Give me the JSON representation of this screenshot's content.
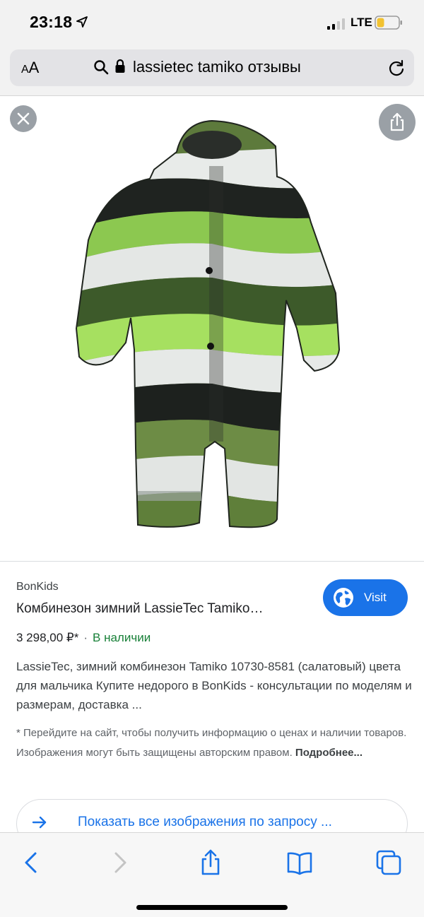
{
  "status_bar": {
    "time": "23:18",
    "network": "LTE"
  },
  "browser": {
    "text_size_label": "AA",
    "url_text": "lassietec tamiko отзывы"
  },
  "result": {
    "source": "BonKids",
    "title": "Комбинезон зимний LassieTec Tamiko…",
    "visit_label": "Visit",
    "price": "3 298,00 ₽*",
    "separator": "·",
    "availability": "В наличии",
    "description": "LassieTec, зимний комбинезон Tamiko 10730-8581 (салатовый) цвета для мальчика Купите недорого в BonKids - консультации по моделям и размерам, доставка ...",
    "disclaimer": "* Перейдите на сайт, чтобы получить информацию о ценах и наличии товаров. Изображения могут быть защищены авторским правом.",
    "more_link": "Подробнее...",
    "show_all_label": "Показать все изображения по запросу ..."
  },
  "colors": {
    "accent_blue": "#1a73e8",
    "in_stock_green": "#188038",
    "overlay_gray": "#9aa0a6"
  },
  "icons": {
    "close": "close-icon",
    "share": "share-icon",
    "search": "search-icon",
    "lock": "lock-icon",
    "reload": "reload-icon",
    "globe": "globe-icon",
    "arrow_right": "arrow-right-icon",
    "back": "back-icon",
    "forward": "forward-icon",
    "bookmarks": "bookmarks-icon",
    "tabs": "tabs-icon"
  }
}
